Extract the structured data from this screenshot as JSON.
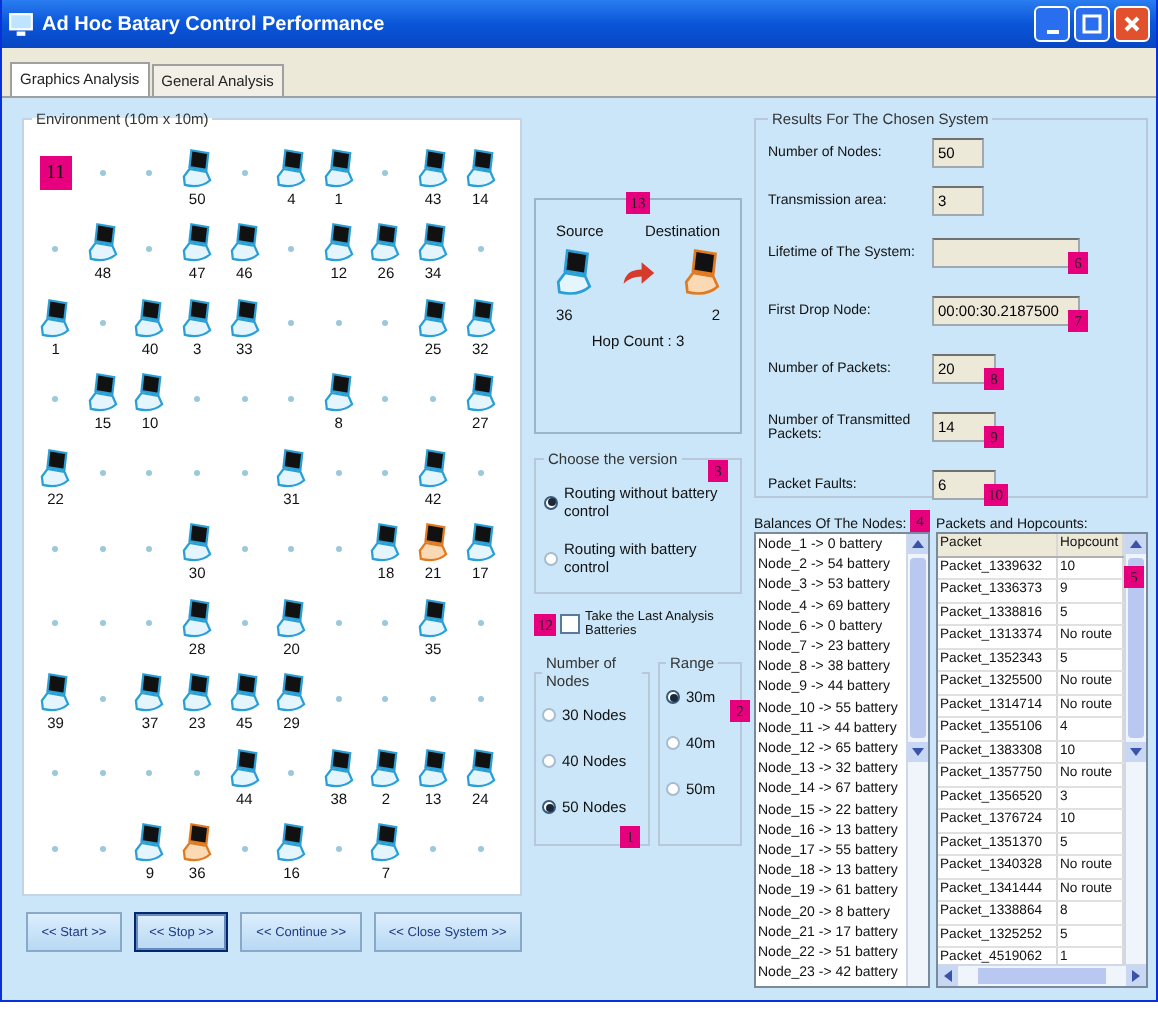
{
  "window": {
    "title": "Ad Hoc Batary Control Performance"
  },
  "tabs": [
    {
      "label": "Graphics Analysis",
      "selected": true
    },
    {
      "label": "General Analysis",
      "selected": false
    }
  ],
  "environment": {
    "title": "Environment (10m x 10m)",
    "rows": [
      [
        {
          "kind": "marker",
          "label": "11"
        },
        {
          "kind": "dot"
        },
        {
          "kind": "dot"
        },
        {
          "kind": "node",
          "label": "50",
          "highlighted": false
        },
        {
          "kind": "dot"
        },
        {
          "kind": "node",
          "label": "4",
          "highlighted": false
        },
        {
          "kind": "node",
          "label": "1",
          "highlighted": false
        },
        {
          "kind": "dot"
        },
        {
          "kind": "node",
          "label": "43",
          "highlighted": false
        },
        {
          "kind": "node",
          "label": "14",
          "highlighted": false
        }
      ],
      [
        {
          "kind": "dot"
        },
        {
          "kind": "node",
          "label": "48",
          "highlighted": false
        },
        {
          "kind": "dot"
        },
        {
          "kind": "node",
          "label": "47",
          "highlighted": false
        },
        {
          "kind": "node",
          "label": "46",
          "highlighted": false
        },
        {
          "kind": "dot"
        },
        {
          "kind": "node",
          "label": "12",
          "highlighted": false
        },
        {
          "kind": "node",
          "label": "26",
          "highlighted": false
        },
        {
          "kind": "node",
          "label": "34",
          "highlighted": false
        },
        {
          "kind": "dot"
        }
      ],
      [
        {
          "kind": "node",
          "label": "1",
          "highlighted": false
        },
        {
          "kind": "dot"
        },
        {
          "kind": "node",
          "label": "40",
          "highlighted": false
        },
        {
          "kind": "node",
          "label": "3",
          "highlighted": false
        },
        {
          "kind": "node",
          "label": "33",
          "highlighted": false
        },
        {
          "kind": "dot"
        },
        {
          "kind": "dot"
        },
        {
          "kind": "dot"
        },
        {
          "kind": "node",
          "label": "25",
          "highlighted": false
        },
        {
          "kind": "node",
          "label": "32",
          "highlighted": false
        }
      ],
      [
        {
          "kind": "dot"
        },
        {
          "kind": "node",
          "label": "15",
          "highlighted": false
        },
        {
          "kind": "node",
          "label": "10",
          "highlighted": false
        },
        {
          "kind": "dot"
        },
        {
          "kind": "dot"
        },
        {
          "kind": "dot"
        },
        {
          "kind": "node",
          "label": "8",
          "highlighted": false
        },
        {
          "kind": "dot"
        },
        {
          "kind": "dot"
        },
        {
          "kind": "node",
          "label": "27",
          "highlighted": false
        }
      ],
      [
        {
          "kind": "node",
          "label": "22",
          "highlighted": false
        },
        {
          "kind": "dot"
        },
        {
          "kind": "dot"
        },
        {
          "kind": "dot"
        },
        {
          "kind": "dot"
        },
        {
          "kind": "node",
          "label": "31",
          "highlighted": false
        },
        {
          "kind": "dot"
        },
        {
          "kind": "dot"
        },
        {
          "kind": "node",
          "label": "42",
          "highlighted": false
        },
        {
          "kind": "dot"
        }
      ],
      [
        {
          "kind": "dot"
        },
        {
          "kind": "dot"
        },
        {
          "kind": "dot"
        },
        {
          "kind": "node",
          "label": "30",
          "highlighted": false
        },
        {
          "kind": "dot"
        },
        {
          "kind": "dot"
        },
        {
          "kind": "dot"
        },
        {
          "kind": "node",
          "label": "18",
          "highlighted": false
        },
        {
          "kind": "node",
          "label": "21",
          "highlighted": true
        },
        {
          "kind": "node",
          "label": "17",
          "highlighted": false
        }
      ],
      [
        {
          "kind": "dot"
        },
        {
          "kind": "dot"
        },
        {
          "kind": "dot"
        },
        {
          "kind": "node",
          "label": "28",
          "highlighted": false
        },
        {
          "kind": "dot"
        },
        {
          "kind": "node",
          "label": "20",
          "highlighted": false
        },
        {
          "kind": "dot"
        },
        {
          "kind": "dot"
        },
        {
          "kind": "node",
          "label": "35",
          "highlighted": false
        },
        {
          "kind": "dot"
        }
      ],
      [
        {
          "kind": "node",
          "label": "39",
          "highlighted": false
        },
        {
          "kind": "dot"
        },
        {
          "kind": "node",
          "label": "37",
          "highlighted": false
        },
        {
          "kind": "node",
          "label": "23",
          "highlighted": false
        },
        {
          "kind": "node",
          "label": "45",
          "highlighted": false
        },
        {
          "kind": "node",
          "label": "29",
          "highlighted": false
        },
        {
          "kind": "dot"
        },
        {
          "kind": "dot"
        },
        {
          "kind": "dot"
        },
        {
          "kind": "dot"
        }
      ],
      [
        {
          "kind": "dot"
        },
        {
          "kind": "dot"
        },
        {
          "kind": "dot"
        },
        {
          "kind": "dot"
        },
        {
          "kind": "node",
          "label": "44",
          "highlighted": false
        },
        {
          "kind": "dot"
        },
        {
          "kind": "node",
          "label": "38",
          "highlighted": false
        },
        {
          "kind": "node",
          "label": "2",
          "highlighted": false
        },
        {
          "kind": "node",
          "label": "13",
          "highlighted": false
        },
        {
          "kind": "node",
          "label": "24",
          "highlighted": false
        }
      ],
      [
        {
          "kind": "dot"
        },
        {
          "kind": "dot"
        },
        {
          "kind": "node",
          "label": "9",
          "highlighted": false
        },
        {
          "kind": "node",
          "label": "36",
          "highlighted": true
        },
        {
          "kind": "dot"
        },
        {
          "kind": "node",
          "label": "16",
          "highlighted": false
        },
        {
          "kind": "dot"
        },
        {
          "kind": "node",
          "label": "7",
          "highlighted": false
        },
        {
          "kind": "dot"
        },
        {
          "kind": "dot"
        }
      ]
    ]
  },
  "buttons": [
    {
      "label": "<< Start >>",
      "focused": false
    },
    {
      "label": "<< Stop >>",
      "focused": true
    },
    {
      "label": "<< Continue >>",
      "focused": false
    },
    {
      "label": "<< Close System >>",
      "focused": false
    }
  ],
  "route": {
    "marker": "13",
    "source_label": "Source",
    "destination_label": "Destination",
    "source_node": "36",
    "destination_node": "2",
    "hop_count": "Hop Count : 3"
  },
  "version": {
    "title": "Choose the version",
    "marker": "3",
    "options": [
      {
        "label": "Routing without battery control",
        "selected": true
      },
      {
        "label": "Routing with battery control",
        "selected": false
      }
    ]
  },
  "history": {
    "marker": "12",
    "label": "Take the Last Analysis Batteries",
    "checked": false
  },
  "node_count": {
    "title": "Number of Nodes",
    "marker": "1",
    "options": [
      {
        "label": "30 Nodes",
        "selected": false
      },
      {
        "label": "40 Nodes",
        "selected": false
      },
      {
        "label": "50 Nodes",
        "selected": true
      }
    ]
  },
  "range": {
    "title": "Range",
    "marker": "2",
    "options": [
      {
        "label": "30m",
        "selected": true
      },
      {
        "label": "40m",
        "selected": false
      },
      {
        "label": "50m",
        "selected": false
      }
    ]
  },
  "results": {
    "title": "Results For The Chosen System",
    "fields": [
      {
        "label": "Number of Nodes:",
        "value": "50"
      },
      {
        "label": "Transmission area:",
        "value": "3"
      },
      {
        "label": "Lifetime of The System:",
        "marker": "6"
      },
      {
        "label": "First Drop Node:",
        "value": "00:00:30.2187500",
        "marker": "7"
      },
      {
        "label": "Number of Packets:",
        "value": "20",
        "marker": "8"
      },
      {
        "label": "Number of Transmitted Packets:",
        "value": "14",
        "marker": "9"
      },
      {
        "label": "Packet Faults:",
        "value": "6",
        "marker": "10"
      }
    ]
  },
  "balances": {
    "title": "Balances Of The Nodes:",
    "marker": "4",
    "items": [
      "Node_1 -> 0 battery",
      "Node_2 -> 54 battery",
      "Node_3 -> 53 battery",
      "Node_4 -> 69 battery",
      "Node_6 -> 0 battery",
      "Node_7 -> 23 battery",
      "Node_8 -> 38 battery",
      "Node_9 -> 44 battery",
      "Node_10 -> 55 battery",
      "Node_11 -> 44 battery",
      "Node_12 -> 65 battery",
      "Node_13 -> 32 battery",
      "Node_14 -> 67 battery",
      "Node_15 -> 22 battery",
      "Node_16 -> 13 battery",
      "Node_17 -> 55 battery",
      "Node_18 -> 13 battery",
      "Node_19 -> 61 battery",
      "Node_20 -> 8 battery",
      "Node_21 -> 17 battery",
      "Node_22 -> 51 battery",
      "Node_23 -> 42 battery"
    ]
  },
  "packets": {
    "title": "Packets and Hopcounts:",
    "marker": "5",
    "columns": [
      "Packet",
      "Hopcount"
    ],
    "rows": [
      [
        "Packet_1339632",
        "10"
      ],
      [
        "Packet_1336373",
        "9"
      ],
      [
        "Packet_1338816",
        "5"
      ],
      [
        "Packet_1313374",
        "No route"
      ],
      [
        "Packet_1352343",
        "5"
      ],
      [
        "Packet_1325500",
        "No route"
      ],
      [
        "Packet_1314714",
        "No route"
      ],
      [
        "Packet_1355106",
        "4"
      ],
      [
        "Packet_1383308",
        "10"
      ],
      [
        "Packet_1357750",
        "No route"
      ],
      [
        "Packet_1356520",
        "3"
      ],
      [
        "Packet_1376724",
        "10"
      ],
      [
        "Packet_1351370",
        "5"
      ],
      [
        "Packet_1340328",
        "No route"
      ],
      [
        "Packet_1341444",
        "No route"
      ],
      [
        "Packet_1338864",
        "8"
      ],
      [
        "Packet_1325252",
        "5"
      ],
      [
        "Packet_4519062",
        "1"
      ]
    ]
  }
}
